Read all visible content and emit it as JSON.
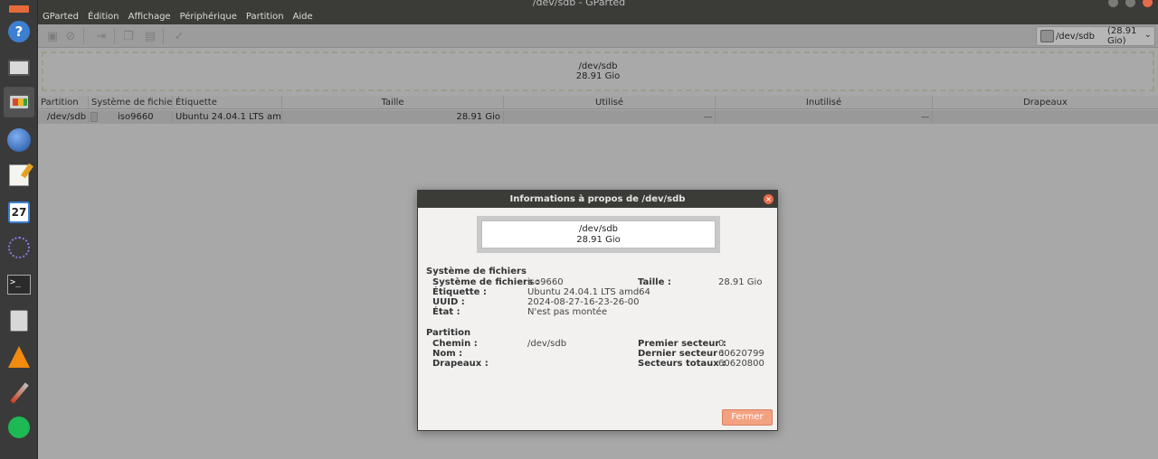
{
  "window": {
    "title": "/dev/sdb - GParted"
  },
  "menubar": {
    "items": [
      "GParted",
      "Édition",
      "Affichage",
      "Périphérique",
      "Partition",
      "Aide"
    ]
  },
  "device_selector": {
    "device": "/dev/sdb",
    "size": "(28.91 Gio)"
  },
  "disk_map": {
    "device": "/dev/sdb",
    "size": "28.91 Gio"
  },
  "table": {
    "headers": [
      "Partition",
      "Système de fichiers",
      "Étiquette",
      "Taille",
      "Utilisé",
      "Inutilisé",
      "Drapeaux"
    ],
    "rows": [
      {
        "partition": "/dev/sdb",
        "filesystem": "iso9660",
        "label": "Ubuntu 24.04.1 LTS amd64",
        "size": "28.91 Gio",
        "used": "---",
        "unused": "---",
        "flags": ""
      }
    ]
  },
  "dialog": {
    "title": "Informations à propos de /dev/sdb",
    "map": {
      "device": "/dev/sdb",
      "size": "28.91 Gio"
    },
    "filesystem_section": {
      "title": "Système de fichiers",
      "fs_label": "Système de fichiers :",
      "fs_value": "iso9660",
      "label_label": "Étiquette :",
      "label_value": "Ubuntu 24.04.1 LTS amd64",
      "uuid_label": "UUID :",
      "uuid_value": "2024-08-27-16-23-26-00",
      "state_label": "État :",
      "state_value": "N'est pas montée",
      "size_label": "Taille :",
      "size_value": "28.91 Gio"
    },
    "partition_section": {
      "title": "Partition",
      "path_label": "Chemin :",
      "path_value": "/dev/sdb",
      "name_label": "Nom :",
      "flags_label": "Drapeaux :",
      "first_sector_label": "Premier secteur :",
      "first_sector_value": "0",
      "last_sector_label": "Dernier secteur :",
      "last_sector_value": "60620799",
      "total_sectors_label": "Secteurs totaux :",
      "total_sectors_value": "60620800"
    },
    "close_button": "Fermer"
  },
  "dock": {
    "icons": [
      "help-icon",
      "scanner-icon",
      "gparted-icon",
      "browser-icon",
      "text-editor-icon",
      "calendar-icon",
      "dots-icon",
      "terminal-icon",
      "calculator-icon",
      "vlc-icon",
      "brush-icon",
      "spotify-icon"
    ],
    "calendar_day": "27"
  },
  "colors": {
    "close_button": "#f4a182",
    "dialog_close": "#e46a4a",
    "header_bar": "#3b3b37"
  }
}
